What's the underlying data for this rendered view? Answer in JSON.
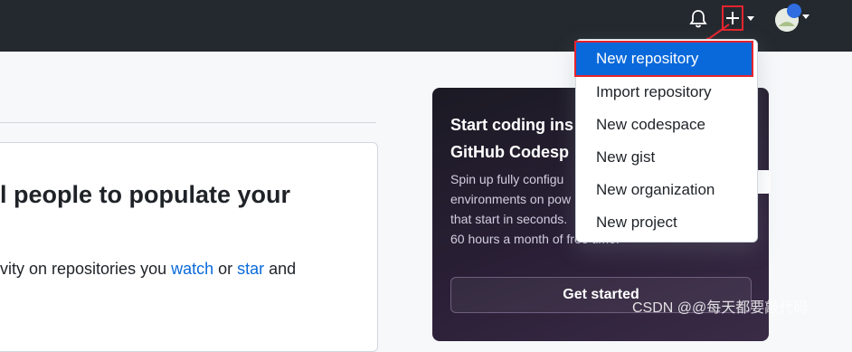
{
  "header": {
    "notifications_icon": "bell-icon",
    "create_icon": "plus-icon",
    "avatar_icon": "avatar"
  },
  "dropdown": {
    "items": [
      {
        "label": "New repository",
        "active": true
      },
      {
        "label": "Import repository"
      },
      {
        "label": "New codespace"
      },
      {
        "label": "New gist"
      },
      {
        "label": "New organization"
      },
      {
        "label": "New project"
      }
    ]
  },
  "feed": {
    "title": "l people to populate your",
    "text_prefix": "vity on repositories you ",
    "watch_link": "watch",
    "text_middle": " or ",
    "star_link": "star",
    "text_suffix": " and"
  },
  "promo": {
    "title": "Start coding ins\nGitHub Codesp",
    "body": "Spin up fully configu\nenvironments on pow\nthat start in seconds.\n60 hours a month of free time.",
    "button_label": "Get started"
  },
  "watermark": "CSDN @@每天都要敲代码",
  "colors": {
    "header_bg": "#24292f",
    "accent_blue": "#0969da",
    "highlight_red": "#e5242e"
  }
}
